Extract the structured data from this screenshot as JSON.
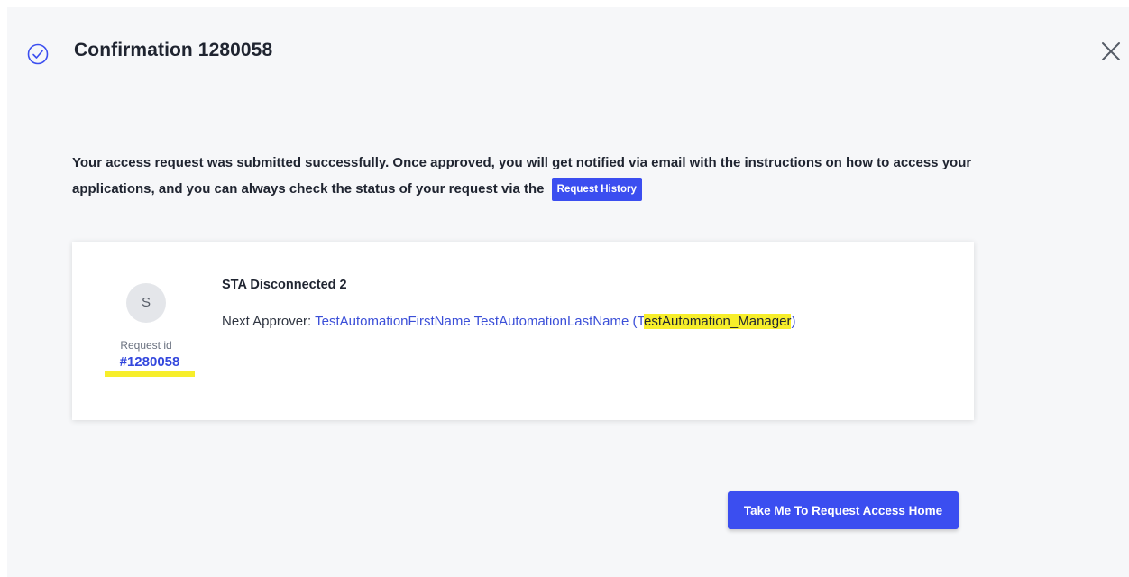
{
  "dialog": {
    "title": "Confirmation 1280058",
    "accent_color": "#3b4ef0",
    "highlight_color": "#f7ee2a"
  },
  "message": {
    "text": "Your access request was submitted successfully. Once approved, you will get notified via email with the instructions on how to access your applications, and you can always check the status of your request via the",
    "link_label": "Request History"
  },
  "request": {
    "avatar_initial": "S",
    "id_label": "Request id",
    "id_value": "#1280058",
    "application": "STA Disconnected 2",
    "next_approver_label": "Next Approver:",
    "approver_name": "TestAutomationFirstName TestAutomationLastName",
    "approver_open": "(T",
    "approver_username": "estAutomation_Manager",
    "approver_close": ")"
  },
  "actions": {
    "home_button": "Take Me To Request Access Home"
  },
  "icons": {
    "status": "check-circle-icon",
    "close": "close-icon"
  }
}
